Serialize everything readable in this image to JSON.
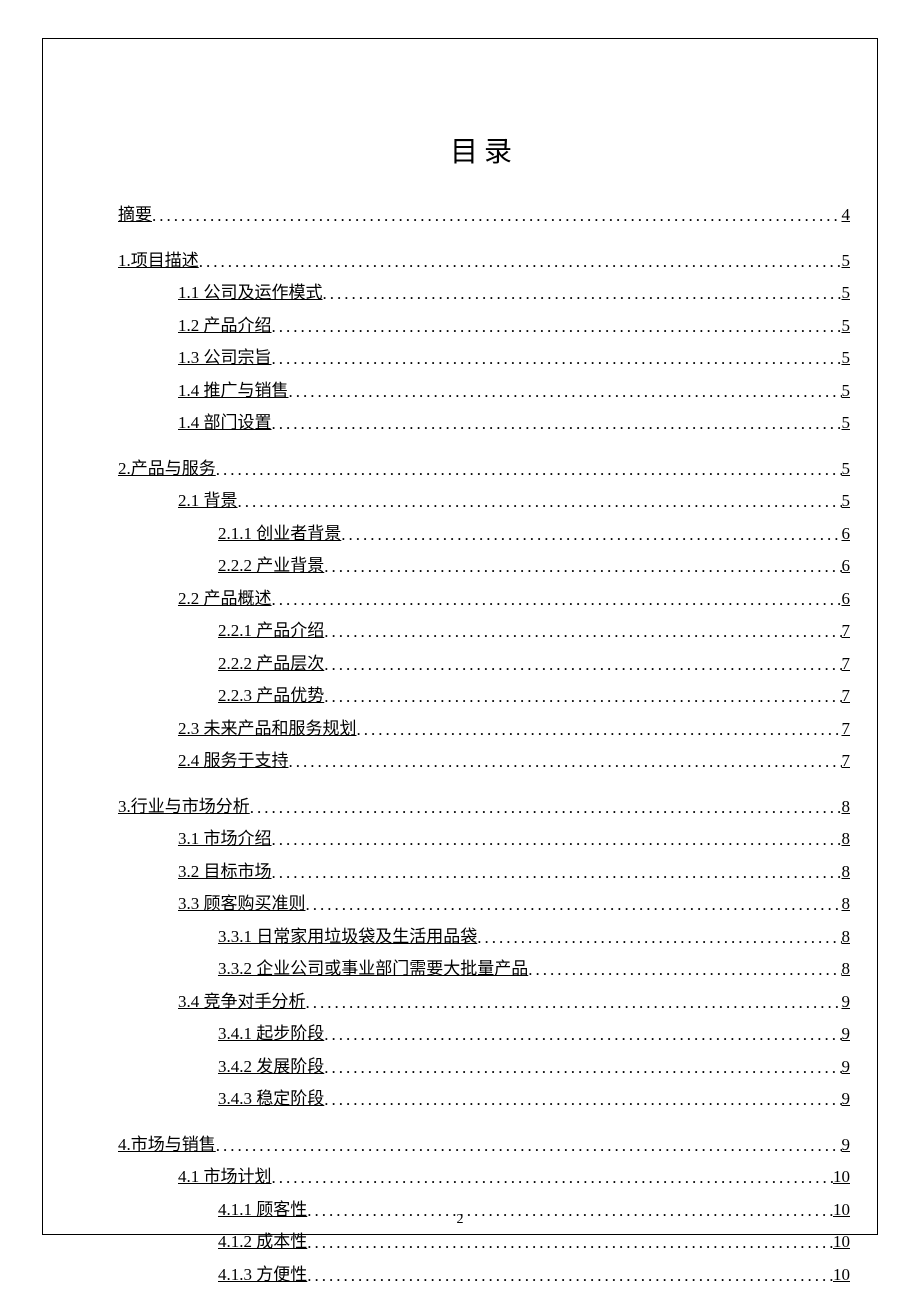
{
  "title": "目录",
  "page_number": "2",
  "entries": [
    {
      "level": 0,
      "text": "摘要",
      "page": "4",
      "gap": false
    },
    {
      "level": 0,
      "text": "1.项目描述",
      "page": "5",
      "gap": true
    },
    {
      "level": 1,
      "text": "1.1 公司及运作模式",
      "page": "5",
      "gap": false
    },
    {
      "level": 1,
      "text": "1.2 产品介绍",
      "page": "5",
      "gap": false
    },
    {
      "level": 1,
      "text": "1.3 公司宗旨",
      "page": "5",
      "gap": false
    },
    {
      "level": 1,
      "text": "1.4 推广与销售",
      "page": "5",
      "gap": false
    },
    {
      "level": 1,
      "text": "1.4 部门设置",
      "page": "5",
      "gap": false
    },
    {
      "level": 0,
      "text": "2.产品与服务",
      "page": "5",
      "gap": true
    },
    {
      "level": 1,
      "text": "2.1 背景",
      "page": "5",
      "gap": false
    },
    {
      "level": 2,
      "text": "2.1.1 创业者背景",
      "page": "6",
      "gap": false
    },
    {
      "level": 2,
      "text": "2.2.2 产业背景",
      "page": "6",
      "gap": false
    },
    {
      "level": 1,
      "text": "2.2 产品概述",
      "page": "6",
      "gap": false
    },
    {
      "level": 2,
      "text": "2.2.1 产品介绍",
      "page": "7",
      "gap": false
    },
    {
      "level": 2,
      "text": "2.2.2 产品层次",
      "page": "7",
      "gap": false
    },
    {
      "level": 2,
      "text": "2.2.3 产品优势",
      "page": "7",
      "gap": false
    },
    {
      "level": 1,
      "text": "2.3 未来产品和服务规划",
      "page": "7",
      "gap": false
    },
    {
      "level": 1,
      "text": "2.4 服务于支持",
      "page": "7",
      "gap": false
    },
    {
      "level": 0,
      "text": "3.行业与市场分析",
      "page": "8",
      "gap": true
    },
    {
      "level": 1,
      "text": "3.1 市场介绍",
      "page": "8",
      "gap": false
    },
    {
      "level": 1,
      "text": "3.2 目标市场",
      "page": "8",
      "gap": false
    },
    {
      "level": 1,
      "text": "3.3 顾客购买准则",
      "page": "8",
      "gap": false
    },
    {
      "level": 2,
      "text": "3.3.1 日常家用垃圾袋及生活用品袋",
      "page": "8",
      "gap": false
    },
    {
      "level": 2,
      "text": "3.3.2 企业公司或事业部门需要大批量产品",
      "page": "8",
      "gap": false
    },
    {
      "level": 1,
      "text": "3.4 竞争对手分析",
      "page": "9",
      "gap": false
    },
    {
      "level": 2,
      "text": "3.4.1 起步阶段",
      "page": "9",
      "gap": false
    },
    {
      "level": 2,
      "text": "3.4.2 发展阶段",
      "page": "9",
      "gap": false
    },
    {
      "level": 2,
      "text": "3.4.3 稳定阶段",
      "page": "9",
      "gap": false
    },
    {
      "level": 0,
      "text": "4.市场与销售",
      "page": "9",
      "gap": true
    },
    {
      "level": 1,
      "text": "4.1 市场计划",
      "page": "10",
      "gap": false
    },
    {
      "level": 2,
      "text": "4.1.1 顾客性",
      "page": "10",
      "gap": false
    },
    {
      "level": 2,
      "text": "4.1.2 成本性",
      "page": "10",
      "gap": false
    },
    {
      "level": 2,
      "text": "4.1.3 方便性",
      "page": "10",
      "gap": false
    }
  ]
}
